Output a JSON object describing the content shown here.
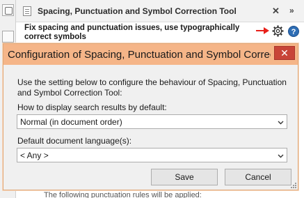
{
  "panel": {
    "title": "Spacing, Punctuation and Symbol Correction Tool",
    "close_glyph": "✕",
    "more_glyph": "»",
    "subtitle": "Fix spacing and punctuation issues, use typographically correct symbols",
    "help_glyph": "?",
    "footer_text": "The following punctuation rules will be applied:"
  },
  "dialog": {
    "title": "Configuration of Spacing, Punctuation and Symbol Correction Tool",
    "close_glyph": "✕",
    "description": "Use the setting below to configure the behaviour of Spacing, Punctuation and Symbol Correction Tool:",
    "display_label": "How to display search results by default:",
    "display_value": "Normal (in document order)",
    "language_label": "Default document language(s):",
    "language_value": "< Any >",
    "save_label": "Save",
    "cancel_label": "Cancel"
  },
  "colors": {
    "titlebar": "#f5b588",
    "close_button": "#c84438",
    "help_icon": "#2e6db4",
    "arrow": "#e8201a"
  }
}
